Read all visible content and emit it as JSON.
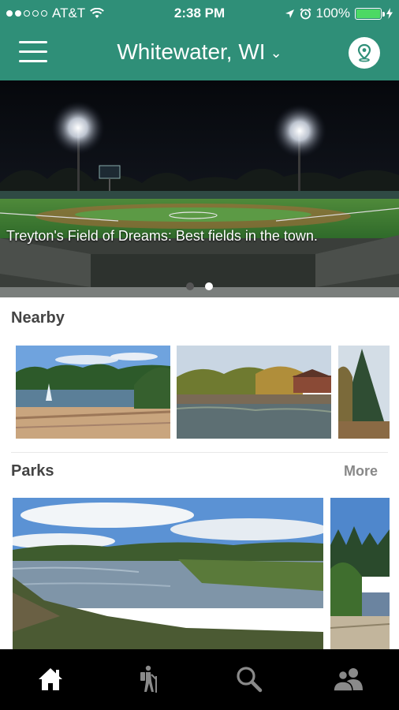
{
  "status_bar": {
    "carrier": "AT&T",
    "time": "2:38 PM",
    "battery_percent": "100%",
    "signal_bars_filled": 2,
    "signal_bars_total": 5
  },
  "nav": {
    "city": "Whitewater, WI",
    "menu_icon": "hamburger-menu-icon",
    "location_icon": "map-pin-icon"
  },
  "hero": {
    "caption": "Treyton's Field of Dreams: Best fields in the town.",
    "slides_total": 2,
    "active_slide": 2
  },
  "sections": {
    "nearby": {
      "title": "Nearby"
    },
    "parks": {
      "title": "Parks",
      "more_label": "More"
    }
  },
  "tabs": [
    {
      "icon": "home-icon",
      "active": true
    },
    {
      "icon": "hiker-icon",
      "active": false
    },
    {
      "icon": "search-icon",
      "active": false
    },
    {
      "icon": "people-icon",
      "active": false
    }
  ],
  "colors": {
    "brand_green": "#2f8f78",
    "active_tab": "#ffffff",
    "inactive_tab": "#8a8a8a"
  }
}
